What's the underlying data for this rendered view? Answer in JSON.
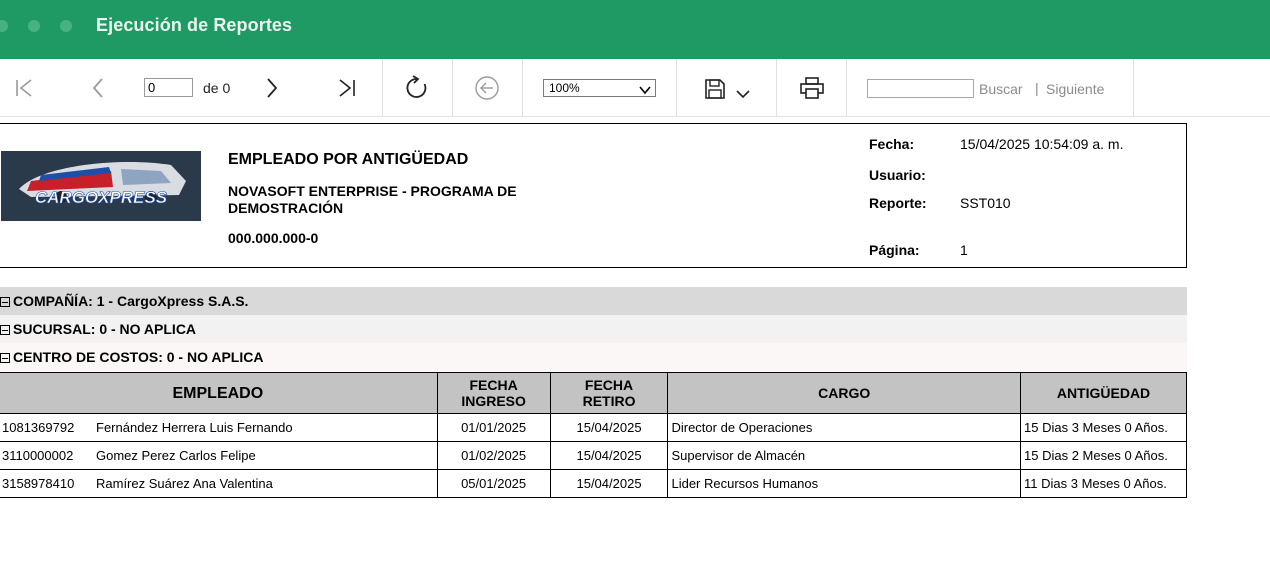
{
  "window": {
    "title": "Ejecución de Reportes"
  },
  "toolbar": {
    "page_value": "0",
    "page_of_label": "de 0",
    "zoom": "100%",
    "search_label": "Buscar",
    "separator": "|",
    "next_label": "Siguiente",
    "icons": [
      "first-page-icon",
      "previous-page-icon",
      "next-page-icon",
      "last-page-icon",
      "refresh-icon",
      "back-icon",
      "save-icon",
      "chevron-down-icon",
      "print-icon"
    ]
  },
  "report": {
    "logo_text": "CARGOXPRESS",
    "title": "EMPLEADO POR ANTIGÜEDAD",
    "company": "NOVASOFT ENTERPRISE - PROGRAMA DE DEMOSTRACIÓN",
    "nit": "000.000.000-0",
    "meta": {
      "fecha_label": "Fecha:",
      "fecha_value": "15/04/2025 10:54:09 a. m.",
      "usuario_label": "Usuario:",
      "usuario_value": "",
      "reporte_label": "Reporte:",
      "reporte_value": "SST010",
      "pagina_label": "Página:",
      "pagina_value": "1"
    },
    "groups": {
      "compania": "COMPAÑÍA: 1 - CargoXpress S.A.S.",
      "sucursal": "SUCURSAL: 0 - NO APLICA",
      "centro": "CENTRO DE COSTOS: 0 - NO APLICA"
    },
    "columns": {
      "empleado": "EMPLEADO",
      "fecha_ingreso_1": "FECHA",
      "fecha_ingreso_2": "INGRESO",
      "fecha_retiro_1": "FECHA",
      "fecha_retiro_2": "RETIRO",
      "cargo": "CARGO",
      "antiguedad": "ANTIGÜEDAD"
    },
    "rows": [
      {
        "id": "1081369792",
        "name": "Fernández Herrera Luis Fernando",
        "ingreso": "01/01/2025",
        "retiro": "15/04/2025",
        "cargo": "Director de Operaciones",
        "antiguedad": "15 Dias 3 Meses 0 Años."
      },
      {
        "id": "3110000002",
        "name": "Gomez Perez Carlos Felipe",
        "ingreso": "01/02/2025",
        "retiro": "15/04/2025",
        "cargo": "Supervisor de Almacén",
        "antiguedad": "15 Dias 2 Meses 0 Años."
      },
      {
        "id": "3158978410",
        "name": "Ramírez Suárez Ana Valentina",
        "ingreso": "05/01/2025",
        "retiro": "15/04/2025",
        "cargo": "Lider Recursos Humanos",
        "antiguedad": "11 Dias 3 Meses 0 Años."
      }
    ]
  },
  "colors": {
    "titlebar": "#1f9a64",
    "header_row": "#c3c3c3",
    "group1": "#d9d9d9",
    "group2": "#f2f2f2",
    "group3": "#fbf7f6"
  }
}
